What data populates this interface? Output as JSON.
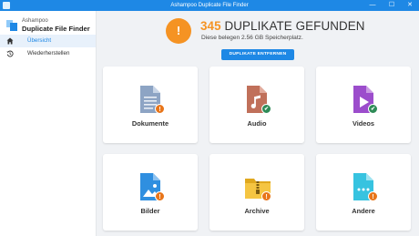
{
  "window": {
    "title": "Ashampoo Duplicate File Finder",
    "controls": [
      "—",
      "☐",
      "✕"
    ]
  },
  "brand": {
    "vendor": "Ashampoo",
    "product": "Duplicate File Finder"
  },
  "sidebar": {
    "items": [
      {
        "label": "Übersicht",
        "icon": "home-icon",
        "active": true
      },
      {
        "label": "Wiederherstellen",
        "icon": "restore-history-icon",
        "active": false
      }
    ]
  },
  "summary": {
    "count": "345",
    "headline_rest": "DUPLIKATE GEFUNDEN",
    "subline": "Diese belegen 2.56 GB Speicherplatz.",
    "warning_glyph": "!",
    "button_label": "DUPLIKATE ENTFERNEN"
  },
  "categories": [
    {
      "label": "Dokumente",
      "icon": "document-icon",
      "status": "warning",
      "badge": "!"
    },
    {
      "label": "Audio",
      "icon": "audio-file-icon",
      "status": "ok",
      "badge": "✔"
    },
    {
      "label": "Videos",
      "icon": "video-file-icon",
      "status": "ok",
      "badge": "✔"
    },
    {
      "label": "Bilder",
      "icon": "image-file-icon",
      "status": "warning",
      "badge": "!"
    },
    {
      "label": "Archive",
      "icon": "archive-folder-icon",
      "status": "warning",
      "badge": "!"
    },
    {
      "label": "Andere",
      "icon": "other-file-icon",
      "status": "warning",
      "badge": "!"
    }
  ],
  "colors": {
    "accent": "#1e88e5",
    "warning": "#f59323",
    "ok": "#2e8b57"
  }
}
